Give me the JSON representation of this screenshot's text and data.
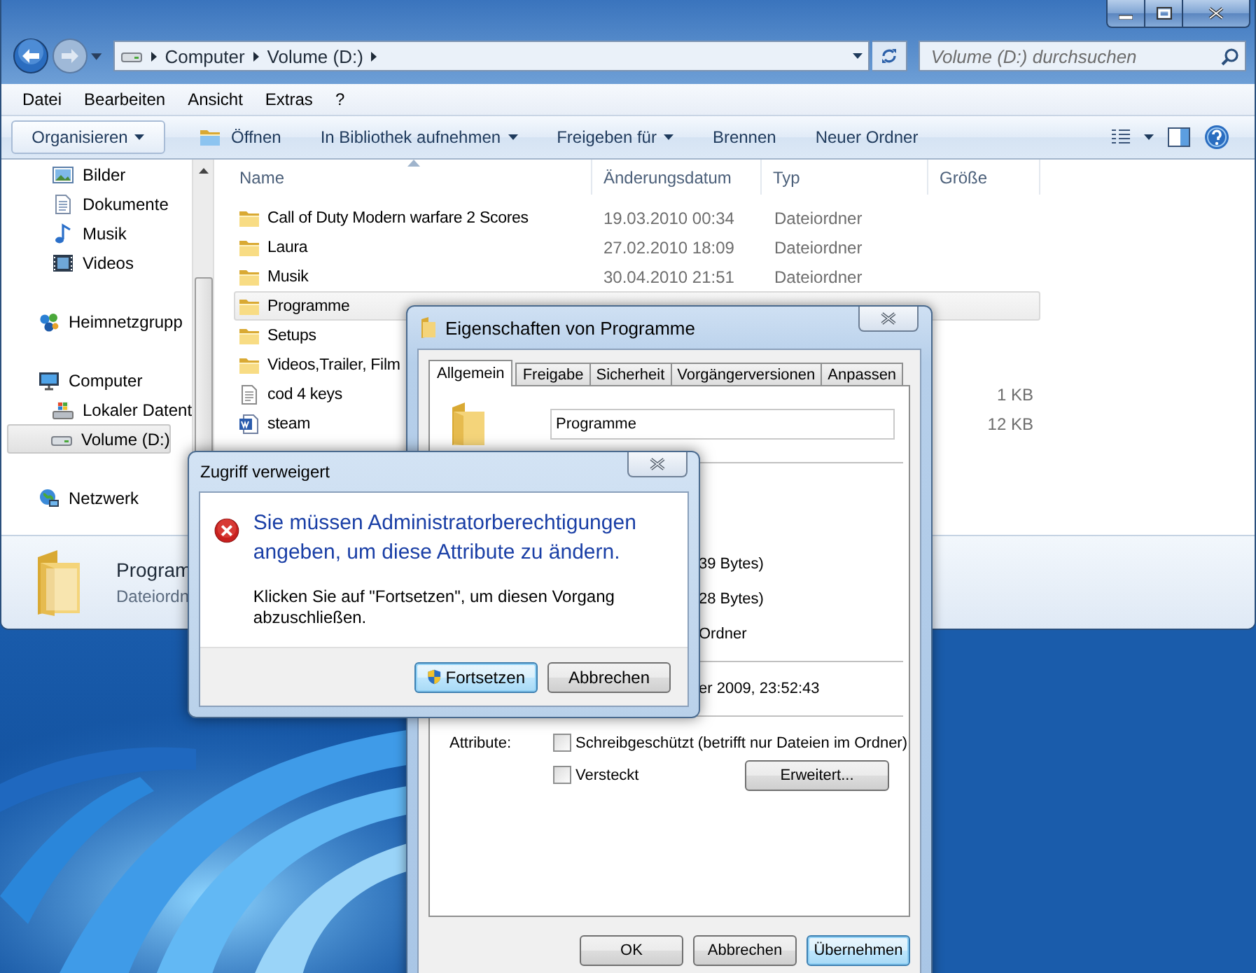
{
  "explorer": {
    "breadcrumb": [
      "Computer",
      "Volume (D:)"
    ],
    "search": {
      "placeholder": "Volume (D:) durchsuchen"
    },
    "menu": [
      "Datei",
      "Bearbeiten",
      "Ansicht",
      "Extras",
      "?"
    ],
    "toolbar": [
      {
        "label": "Organisieren",
        "kind": "button"
      },
      {
        "label": "Öffnen",
        "kind": "icon"
      },
      {
        "label": "In Bibliothek aufnehmen",
        "kind": "menu"
      },
      {
        "label": "Freigeben für",
        "kind": "menu"
      },
      {
        "label": "Brennen",
        "kind": "plain"
      },
      {
        "label": "Neuer Ordner",
        "kind": "plain"
      }
    ],
    "nav": [
      {
        "children": [
          {
            "label": "Bilder",
            "kind": "pictures",
            "selected": false
          },
          {
            "label": "Dokumente",
            "kind": "documents",
            "selected": false
          },
          {
            "label": "Musik",
            "kind": "music",
            "selected": false
          },
          {
            "label": "Videos",
            "kind": "videos",
            "selected": false
          }
        ]
      },
      {
        "label": "Heimnetzgrupp",
        "kind": "homegroup",
        "selected": false
      },
      {
        "label": "Computer",
        "kind": "computer",
        "selected": false,
        "children": [
          {
            "label": "Lokaler Datent",
            "kind": "sysdrive",
            "selected": false
          },
          {
            "label": "Volume (D:)",
            "kind": "drive",
            "selected": true
          }
        ]
      },
      {
        "label": "Netzwerk",
        "kind": "network",
        "selected": false
      }
    ],
    "columns": [
      "Name",
      "Änderungsdatum",
      "Typ",
      "Größe"
    ],
    "rows": [
      {
        "name": "Call of Duty Modern warfare 2 Scores",
        "date": "19.03.2010 00:34",
        "type": "Dateiordner",
        "kind": "folder",
        "selected": false
      },
      {
        "name": "Laura",
        "date": "27.02.2010 18:09",
        "type": "Dateiordner",
        "kind": "folder",
        "selected": false
      },
      {
        "name": "Musik",
        "date": "30.04.2010 21:51",
        "type": "Dateiordner",
        "kind": "folder",
        "selected": false
      },
      {
        "name": "Programme",
        "kind": "folder",
        "selected": true
      },
      {
        "name": "Setups",
        "kind": "folder",
        "selected": false
      },
      {
        "name": "Videos,Trailer, Film",
        "kind": "folder",
        "selected": false
      },
      {
        "name": "cod 4 keys",
        "size": "1 KB",
        "kind": "text",
        "selected": false
      },
      {
        "name": "steam",
        "size": "12 KB",
        "kind": "word",
        "selected": false
      }
    ],
    "details": {
      "name": "Program",
      "type": "Dateiordn"
    }
  },
  "properties": {
    "title": "Eigenschaften von Programme",
    "tabs": [
      {
        "label": "Allgemein",
        "selected": true
      },
      {
        "label": "Freigabe",
        "selected": false
      },
      {
        "label": "Sicherheit",
        "selected": false
      },
      {
        "label": "Vorgängerversionen",
        "selected": false
      },
      {
        "label": "Anpassen",
        "selected": false
      }
    ],
    "name_value": "Programme",
    "info": [
      [
        "39 Bytes)",
        "28 Bytes)",
        "Ordner"
      ],
      [
        "er 2009, 23:52:43"
      ]
    ],
    "attributes_label": "Attribute:",
    "checkboxes": [
      {
        "label": "Schreibgeschützt (betrifft nur Dateien im Ordner)",
        "checked": false
      },
      {
        "label": "Versteckt",
        "checked": false
      }
    ],
    "advanced_button": "Erweitert...",
    "buttons": [
      {
        "label": "OK",
        "default": false
      },
      {
        "label": "Abbrechen",
        "default": false
      },
      {
        "label": "Übernehmen",
        "default": true
      }
    ]
  },
  "error": {
    "title": "Zugriff verweigert",
    "message": "Sie müssen Administratorberechtigungen angeben, um diese Attribute zu ändern.",
    "hint": "Klicken Sie auf \"Fortsetzen\", um diesen Vorgang abzuschließen.",
    "buttons": [
      {
        "label": "Fortsetzen",
        "kind": "shield",
        "default": true
      },
      {
        "label": "Abbrechen",
        "kind": "plain",
        "default": false
      }
    ]
  }
}
